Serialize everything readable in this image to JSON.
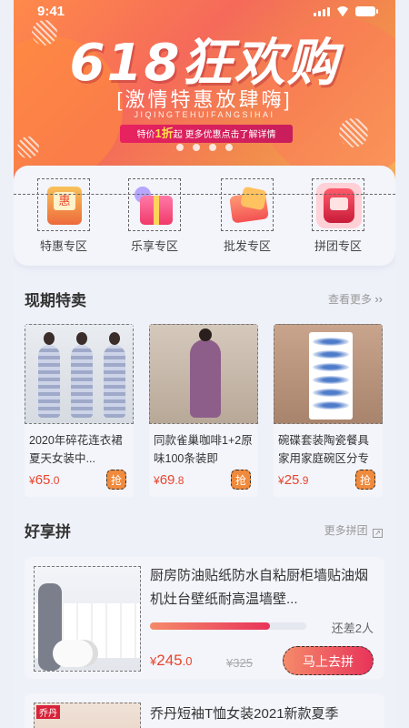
{
  "status": {
    "time": "9:41"
  },
  "banner": {
    "title": "618狂欢购",
    "subtitle": "[激情特惠放肆嗨]",
    "pinyin": "JIQINGTEHUIFANGSIHAI",
    "pill_prefix": "特价",
    "pill_highlight": "1折",
    "pill_suffix": "起 更多优惠点击了解详情"
  },
  "categories": [
    {
      "label": "特惠专区",
      "icon": "discount-box-icon"
    },
    {
      "label": "乐享专区",
      "icon": "gift-box-icon"
    },
    {
      "label": "批发专区",
      "icon": "shopping-bag-icon"
    },
    {
      "label": "拼团专区",
      "icon": "rice-cooker-icon"
    }
  ],
  "flash_sale": {
    "title": "现期特卖",
    "more": "查看更多",
    "more_icon": "double-chevron-right-icon",
    "items": [
      {
        "name": "2020年碎花连衣裙夏天女装中...",
        "currency": "¥",
        "price_int": "65",
        "price_dec": ".0",
        "tag": "抢"
      },
      {
        "name": "同款雀巢咖啡1+2原味100条装即",
        "currency": "¥",
        "price_int": "69",
        "price_dec": ".8",
        "tag": "抢"
      },
      {
        "name": "碗碟套装陶瓷餐具家用家庭碗区分专",
        "currency": "¥",
        "price_int": "25",
        "price_dec": ".9",
        "tag": "抢"
      }
    ]
  },
  "group_buy": {
    "title": "好享拼",
    "more": "更多拼团",
    "more_icon": "grid-arrow-icon",
    "items": [
      {
        "title": "厨房防油贴纸防水自粘厨柜墙贴油烟机灶台壁纸耐高温墙壁...",
        "progress": 0.77,
        "remain": "还差2人",
        "currency": "¥",
        "price_int": "245",
        "price_dec": ".0",
        "original": "¥325",
        "button": "马上去拼"
      },
      {
        "title": "乔丹短袖T恤女装2021新款夏季",
        "image_tag": "乔丹"
      }
    ]
  },
  "colors": {
    "accent": "#e8452c",
    "banner_pink": "#e8225f",
    "button_gradient_start": "#f58a6a",
    "button_gradient_end": "#e8345a"
  }
}
